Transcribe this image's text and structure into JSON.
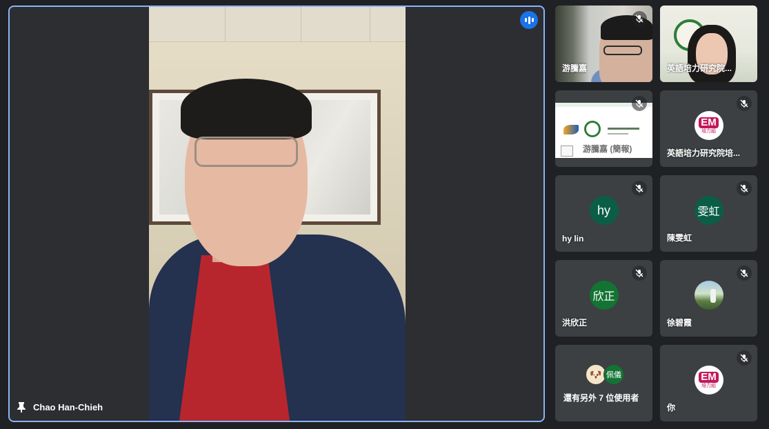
{
  "main_speaker": {
    "name": "Chao Han-Chieh"
  },
  "participants": [
    {
      "name": "游騰嘉",
      "type": "video",
      "muted": true
    },
    {
      "name": "英語培力研究院...",
      "type": "video",
      "muted": false
    },
    {
      "name": "游騰嘉 (簡報)",
      "type": "presentation",
      "muted": true
    },
    {
      "name": "英語培力研究院培...",
      "type": "avatar-logo",
      "avatar_text": "EM",
      "avatar_subtext": "培力組",
      "muted": true
    },
    {
      "name": "hy lin",
      "type": "avatar",
      "avatar_text": "hy",
      "muted": true
    },
    {
      "name": "陳雯虹",
      "type": "avatar",
      "avatar_text": "雯虹",
      "muted": true
    },
    {
      "name": "洪欣正",
      "type": "avatar",
      "avatar_text": "欣正",
      "muted": true
    },
    {
      "name": "徐碧霞",
      "type": "avatar-photo",
      "muted": true
    },
    {
      "name": "你",
      "type": "avatar-logo",
      "avatar_text": "EM",
      "avatar_subtext": "培力組",
      "muted": true
    }
  ],
  "more_participants": {
    "label": "還有另外 7 位使用者",
    "avatar_text": "佩儀"
  },
  "colors": {
    "background": "#202124",
    "tile": "#3c4043",
    "active_border": "#8ab4f8",
    "speaking_indicator": "#1a73e8",
    "avatar_green": "#137333",
    "em_pink": "#c2185b"
  }
}
